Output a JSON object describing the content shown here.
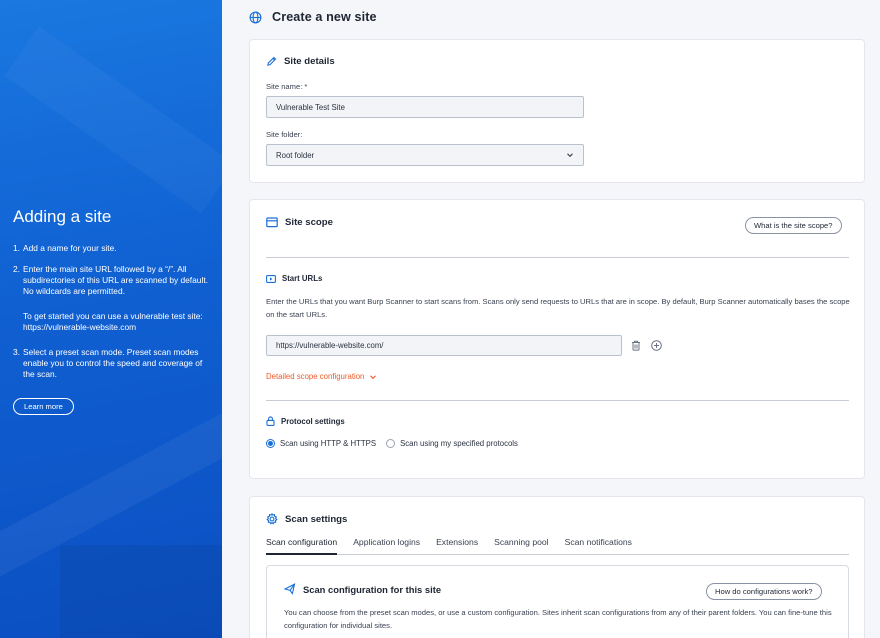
{
  "left_panel": {
    "title": "Adding a site",
    "steps": [
      {
        "num": "1.",
        "text": "Add a name for your site."
      },
      {
        "num": "2.",
        "text": "Enter the main site URL followed by a “/”. All subdirectories of this URL are scanned by default. No wildcards are permitted."
      },
      {
        "num": "3.",
        "text": "Select a preset scan mode. Preset scan modes enable you to control the speed and coverage of the scan."
      }
    ],
    "step2_note": "To get started you can use a vulnerable test site: https://vulnerable-website.com",
    "learn_more": "Learn more"
  },
  "header": {
    "title": "Create a new site",
    "icon": "globe-icon"
  },
  "site_details": {
    "title": "Site details",
    "icon": "pencil-icon",
    "site_name_label": "Site name: *",
    "site_name_value": "Vulnerable Test Site",
    "site_folder_label": "Site folder:",
    "site_folder_value": "Root folder"
  },
  "site_scope": {
    "title": "Site scope",
    "icon": "scope-icon",
    "help_button": "What is the site scope?",
    "start_urls_heading": "Start URLs",
    "start_urls_description": "Enter the URLs that you want Burp Scanner to start scans from. Scans only send requests to URLs that are in scope. By default, Burp Scanner automatically bases the scope on the start URLs.",
    "start_url_value": "https://vulnerable-website.com/",
    "detailed_link": "Detailed scope configuration",
    "protocol_heading": "Protocol settings",
    "protocol_options": [
      {
        "label": "Scan using HTTP & HTTPS",
        "selected": true
      },
      {
        "label": "Scan using my specified protocols",
        "selected": false
      }
    ]
  },
  "scan_settings": {
    "title": "Scan settings",
    "icon": "gear-icon",
    "tabs": [
      "Scan configuration",
      "Application logins",
      "Extensions",
      "Scanning pool",
      "Scan notifications"
    ],
    "active_tab": "Scan configuration",
    "config_title": "Scan configuration for this site",
    "config_help_button": "How do configurations work?",
    "config_description": "You can choose from the preset scan modes, or use a custom configuration. Sites inherit scan configurations from any of their parent folders. You can fine-tune this configuration for individual sites."
  },
  "colors": {
    "accent_blue": "#1a6fd9",
    "orange_link": "#ef5b2b",
    "panel_blue": "#1060d2"
  }
}
